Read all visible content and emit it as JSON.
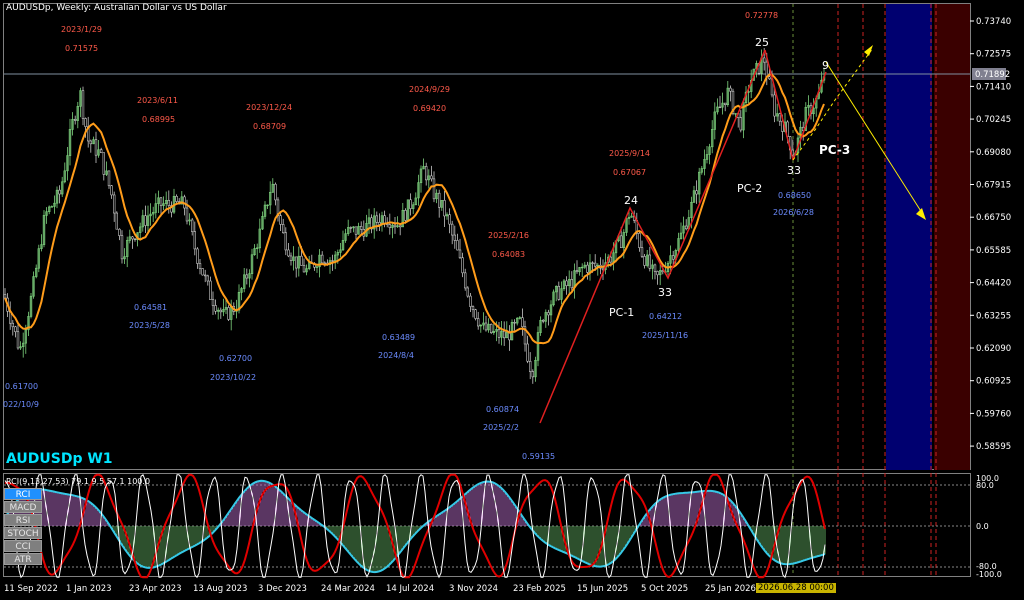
{
  "header": {
    "title": "AUDUSDp, Weekly:  Australian Dollar vs US Dollar"
  },
  "symbol_label": "AUDUSDp W1",
  "price_axis": [
    "0.73740",
    "0.72575",
    "0.71410",
    "0.70245",
    "0.69080",
    "0.67915",
    "0.66750",
    "0.65585",
    "0.64420",
    "0.63255",
    "0.62090",
    "0.60925",
    "0.59760",
    "0.58595"
  ],
  "current_price": "0.71892",
  "annotations_red": [
    {
      "date": "2023/1/29",
      "price": "0.71575"
    },
    {
      "date": "2023/6/11",
      "price": "0.68995"
    },
    {
      "date": "2023/12/24",
      "price": "0.68709"
    },
    {
      "date": "2024/9/29",
      "price": "0.69420"
    },
    {
      "date": "2025/2/16",
      "price": "0.64083"
    },
    {
      "date": "2025/9/14",
      "price": "0.67067"
    },
    {
      "price": "0.72778"
    }
  ],
  "annotations_blue": [
    {
      "date": "022/10/9",
      "price": "0.61700"
    },
    {
      "date": "2023/5/28",
      "price": "0.64581"
    },
    {
      "date": "2023/10/22",
      "price": "0.62700"
    },
    {
      "date": "2024/8/4",
      "price": "0.63489"
    },
    {
      "date": "2025/2/2",
      "price": "0.60874"
    },
    {
      "price": "0.59135"
    },
    {
      "date": "2025/11/16",
      "price": "0.64212"
    },
    {
      "date": "2026/6/28",
      "price": "0.68650"
    }
  ],
  "wave_labels": {
    "w24": "24",
    "w33a": "33",
    "w25": "25",
    "w33b": "33",
    "w9": "9",
    "pc1": "PC-1",
    "pc2": "PC-2",
    "pc3": "PC-3"
  },
  "rci": {
    "header": "RCI(9,13,27,53) 79.1 9.5 57.1 100.0",
    "axis": [
      "100.0",
      "80.0",
      "0.0",
      "-80.0",
      "-100.0"
    ],
    "buttons": [
      "RCI",
      "MACD",
      "RSI",
      "STOCH",
      "CCI",
      "ATR"
    ]
  },
  "time_axis": [
    "11 Sep 2022",
    "1 Jan 2023",
    "23 Apr 2023",
    "13 Aug 2023",
    "3 Dec 2023",
    "24 Mar 2024",
    "14 Jul 2024",
    "3 Nov 2024",
    "23 Feb 2025",
    "15 Jun 2025",
    "5 Oct 2025",
    "25 Jan 2026"
  ],
  "cursor_date": "2026.06.28 00:00",
  "colors": {
    "bull": "#7fd47f",
    "ma": "#ff9c1a",
    "red_label": "#ff5a4a",
    "blue_label": "#6c8cff",
    "rci_fast": "#ffffff",
    "rci_mid": "#e00000",
    "rci_slow": "#36c8e6",
    "future_blue": "#000070",
    "future_red": "#3a0000",
    "arrow": "#ffee00"
  },
  "chart_data": {
    "type": "line",
    "title": "AUDUSDp, Weekly:  Australian Dollar vs US Dollar",
    "x": [
      "2022-09",
      "2022-10",
      "2023-01",
      "2023-02",
      "2023-05",
      "2023-06",
      "2023-10",
      "2023-12",
      "2024-03",
      "2024-08",
      "2024-09",
      "2024-12",
      "2025-02",
      "2025-04",
      "2025-06",
      "2025-09",
      "2025-11",
      "2026-01",
      "2026-03",
      "2026-06",
      "2026-08"
    ],
    "series": [
      {
        "values": [
          0.64,
          0.617,
          0.7,
          0.715,
          0.646,
          0.69,
          0.627,
          0.687,
          0.655,
          0.635,
          0.694,
          0.63,
          0.609,
          0.6,
          0.645,
          0.671,
          0.642,
          0.685,
          0.727,
          0.687,
          0.722
        ]
      }
    ],
    "ylim": [
      0.58,
      0.744
    ]
  }
}
